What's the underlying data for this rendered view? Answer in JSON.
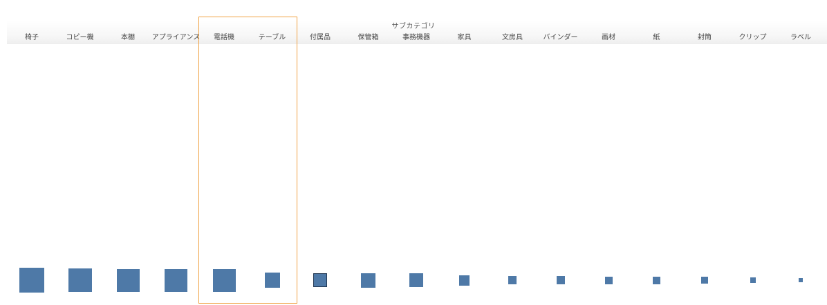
{
  "chart_data": {
    "type": "square-marks",
    "axis_title": "サブカテゴリ",
    "categories": [
      "椅子",
      "コピー機",
      "本棚",
      "アプライアンス",
      "電話機",
      "テーブル",
      "付属品",
      "保管箱",
      "事務機器",
      "家具",
      "文房具",
      "バインダー",
      "画材",
      "紙",
      "封筒",
      "クリップ",
      "ラベル"
    ],
    "values": [
      36,
      34,
      33,
      33,
      33,
      22,
      20,
      21,
      20,
      15,
      12,
      12,
      11,
      11,
      10,
      8,
      6
    ],
    "value_unit": "relative mark size (no printed scale)",
    "selected_category": "付属品",
    "highlighted_categories": [
      "電話機",
      "テーブル"
    ],
    "color": "#4e79a7",
    "highlight_color": "#f0a040"
  }
}
